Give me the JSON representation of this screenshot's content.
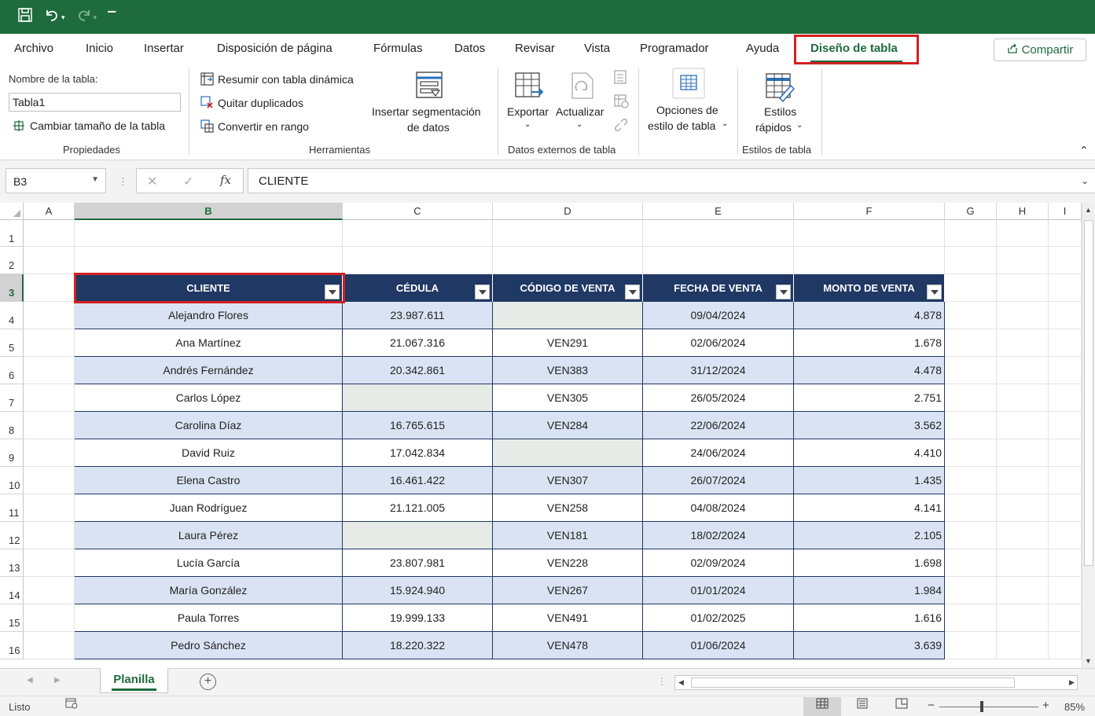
{
  "qat": {
    "save_icon": "save-icon",
    "undo_icon": "undo-icon",
    "redo_icon": "redo-icon",
    "customize_icon": "customize-qat-icon"
  },
  "tabs": [
    "Archivo",
    "Inicio",
    "Insertar",
    "Disposición de página",
    "Fórmulas",
    "Datos",
    "Revisar",
    "Vista",
    "Programador",
    "Ayuda",
    "Diseño de tabla"
  ],
  "share_label": "Compartir",
  "ribbon": {
    "table_name_label": "Nombre de la tabla:",
    "table_name_value": "Tabla1",
    "resize_label": "Cambiar tamaño de la tabla",
    "group_properties": "Propiedades",
    "pivot_label": "Resumir con tabla dinámica",
    "remove_dup_label": "Quitar duplicados",
    "convert_label": "Convertir en rango",
    "slicer_line1": "Insertar segmentación",
    "slicer_line2": "de datos",
    "group_tools": "Herramientas",
    "export_label": "Exportar",
    "refresh_label": "Actualizar",
    "group_external": "Datos externos de tabla",
    "style_opts_line1": "Opciones de",
    "style_opts_line2": "estilo de tabla",
    "quick_styles_line1": "Estilos",
    "quick_styles_line2": "rápidos",
    "group_styles": "Estilos de tabla"
  },
  "formula_bar": {
    "name_box": "B3",
    "cancel": "✕",
    "enter": "✓",
    "fx": "fx",
    "content": "CLIENTE"
  },
  "columns": [
    "A",
    "B",
    "C",
    "D",
    "E",
    "F",
    "G",
    "H",
    "I"
  ],
  "rows": [
    "1",
    "2",
    "3",
    "4",
    "5",
    "6",
    "7",
    "8",
    "9",
    "10",
    "11",
    "12",
    "13",
    "14",
    "15",
    "16"
  ],
  "table": {
    "headers": [
      "CLIENTE",
      "CÉDULA",
      "CÓDIGO DE VENTA",
      "FECHA DE VENTA",
      "MONTO DE VENTA"
    ],
    "rows": [
      [
        "Alejandro Flores",
        "23.987.611",
        "",
        "09/04/2024",
        "4.878"
      ],
      [
        "Ana Martínez",
        "21.067.316",
        "VEN291",
        "02/06/2024",
        "1.678"
      ],
      [
        "Andrés Fernández",
        "20.342.861",
        "VEN383",
        "31/12/2024",
        "4.478"
      ],
      [
        "Carlos López",
        "",
        "VEN305",
        "26/05/2024",
        "2.751"
      ],
      [
        "Carolina Díaz",
        "16.765.615",
        "VEN284",
        "22/06/2024",
        "3.562"
      ],
      [
        "David Ruiz",
        "17.042.834",
        "",
        "24/06/2024",
        "4.410"
      ],
      [
        "Elena Castro",
        "16.461.422",
        "VEN307",
        "26/07/2024",
        "1.435"
      ],
      [
        "Juan Rodríguez",
        "21.121.005",
        "VEN258",
        "04/08/2024",
        "4.141"
      ],
      [
        "Laura Pérez",
        "",
        "VEN181",
        "18/02/2024",
        "2.105"
      ],
      [
        "Lucía García",
        "23.807.981",
        "VEN228",
        "02/09/2024",
        "1.698"
      ],
      [
        "María González",
        "15.924.940",
        "VEN267",
        "01/01/2024",
        "1.984"
      ],
      [
        "Paula Torres",
        "19.999.133",
        "VEN491",
        "01/02/2025",
        "1.616"
      ],
      [
        "Pedro Sánchez",
        "18.220.322",
        "VEN478",
        "01/06/2024",
        "3.639"
      ]
    ]
  },
  "sheet_tab": "Planilla",
  "status": {
    "ready": "Listo",
    "zoom": "85%"
  },
  "colors": {
    "accent": "#1e6b3e",
    "table_header": "#1f3864",
    "band": "#dae3f3",
    "highlight": "#d32020"
  }
}
